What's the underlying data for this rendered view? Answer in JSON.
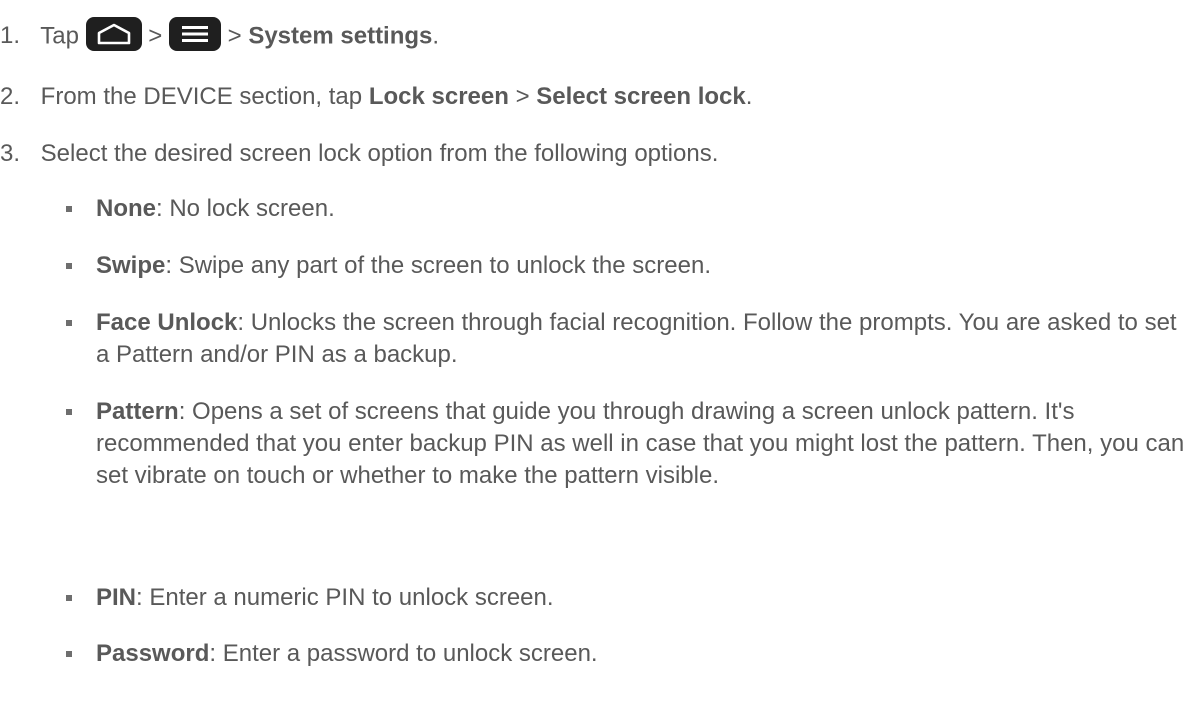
{
  "steps": [
    {
      "num": "1.",
      "text_1": "Tap",
      "sep_1": ">",
      "sep_2": ">",
      "bold_1": "System settings",
      "end": ".",
      "icons": [
        "home-key-icon",
        "menu-key-icon"
      ]
    },
    {
      "num": "2.",
      "text_1": "From the DEVICE section, tap",
      "bold_1": "Lock screen",
      "sep_1": ">",
      "bold_2": "Select screen lock",
      "end": "."
    },
    {
      "num": "3.",
      "text_1": "Select the desired screen lock option from the following options."
    }
  ],
  "options": [
    {
      "term": "None",
      "desc": ": No lock screen."
    },
    {
      "term": "Swipe",
      "desc": ": Swipe any part of the screen to unlock the screen."
    },
    {
      "term": "Face Unlock",
      "desc": ": Unlocks the screen through facial recognition. Follow the prompts. You are asked to set a Pattern and/or PIN as a backup."
    },
    {
      "term": "Pattern",
      "desc": ": Opens a set of screens that guide you through drawing a screen unlock pattern. It's recommended that you enter backup PIN as well in case that you might lost the pattern. Then, you can set vibrate on touch or whether to make the pattern visible."
    },
    {
      "term": "PIN",
      "desc": ": Enter a numeric PIN to unlock screen."
    },
    {
      "term": "Password",
      "desc": ": Enter a password to unlock screen."
    }
  ],
  "colors": {
    "text": "#595959",
    "key_background": "#1f1f1f",
    "key_glyph": "#ffffff",
    "bullet": "#6e6e6e"
  }
}
